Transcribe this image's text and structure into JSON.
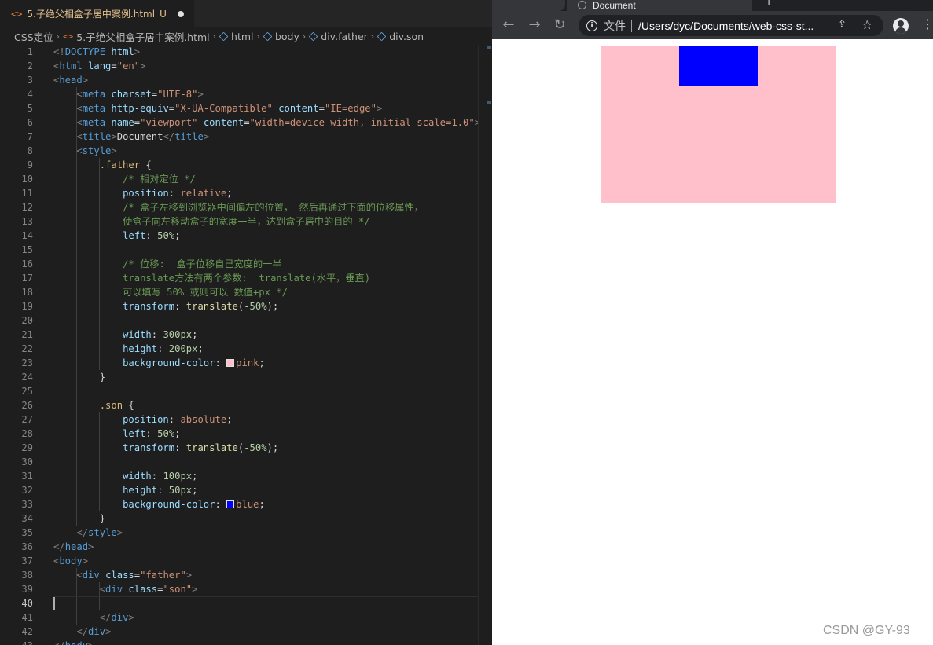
{
  "editor": {
    "tab": {
      "file_icon": "<>",
      "filename": "5.子绝父相盒子居中案例.html",
      "status": "U"
    },
    "breadcrumb": [
      "CSS定位",
      "5.子绝父相盒子居中案例.html",
      "html",
      "body",
      "div.father",
      "div.son"
    ],
    "active_line": 40,
    "lines": [
      [
        {
          "c": "p",
          "t": "<!"
        },
        {
          "c": "t",
          "t": "DOCTYPE"
        },
        {
          "c": "w",
          "t": " "
        },
        {
          "c": "a",
          "t": "html"
        },
        {
          "c": "p",
          "t": ">"
        }
      ],
      [
        {
          "c": "p",
          "t": "<"
        },
        {
          "c": "t",
          "t": "html"
        },
        {
          "c": "w",
          "t": " "
        },
        {
          "c": "a",
          "t": "lang"
        },
        {
          "c": "w",
          "t": "="
        },
        {
          "c": "s",
          "t": "\"en\""
        },
        {
          "c": "p",
          "t": ">"
        }
      ],
      [
        {
          "c": "p",
          "t": "<"
        },
        {
          "c": "t",
          "t": "head"
        },
        {
          "c": "p",
          "t": ">"
        }
      ],
      [
        {
          "c": "w",
          "t": "    "
        },
        {
          "c": "p",
          "t": "<"
        },
        {
          "c": "t",
          "t": "meta"
        },
        {
          "c": "w",
          "t": " "
        },
        {
          "c": "a",
          "t": "charset"
        },
        {
          "c": "w",
          "t": "="
        },
        {
          "c": "s",
          "t": "\"UTF-8\""
        },
        {
          "c": "p",
          "t": ">"
        }
      ],
      [
        {
          "c": "w",
          "t": "    "
        },
        {
          "c": "p",
          "t": "<"
        },
        {
          "c": "t",
          "t": "meta"
        },
        {
          "c": "w",
          "t": " "
        },
        {
          "c": "a",
          "t": "http-equiv"
        },
        {
          "c": "w",
          "t": "="
        },
        {
          "c": "s",
          "t": "\"X-UA-Compatible\""
        },
        {
          "c": "w",
          "t": " "
        },
        {
          "c": "a",
          "t": "content"
        },
        {
          "c": "w",
          "t": "="
        },
        {
          "c": "s",
          "t": "\"IE=edge\""
        },
        {
          "c": "p",
          "t": ">"
        }
      ],
      [
        {
          "c": "w",
          "t": "    "
        },
        {
          "c": "p",
          "t": "<"
        },
        {
          "c": "t",
          "t": "meta"
        },
        {
          "c": "w",
          "t": " "
        },
        {
          "c": "a",
          "t": "name"
        },
        {
          "c": "w",
          "t": "="
        },
        {
          "c": "s",
          "t": "\"viewport\""
        },
        {
          "c": "w",
          "t": " "
        },
        {
          "c": "a",
          "t": "content"
        },
        {
          "c": "w",
          "t": "="
        },
        {
          "c": "s",
          "t": "\"width=device-width, initial-scale=1.0\""
        },
        {
          "c": "p",
          "t": ">"
        }
      ],
      [
        {
          "c": "w",
          "t": "    "
        },
        {
          "c": "p",
          "t": "<"
        },
        {
          "c": "t",
          "t": "title"
        },
        {
          "c": "p",
          "t": ">"
        },
        {
          "c": "w",
          "t": "Document"
        },
        {
          "c": "p",
          "t": "</"
        },
        {
          "c": "t",
          "t": "title"
        },
        {
          "c": "p",
          "t": ">"
        }
      ],
      [
        {
          "c": "w",
          "t": "    "
        },
        {
          "c": "p",
          "t": "<"
        },
        {
          "c": "t",
          "t": "style"
        },
        {
          "c": "p",
          "t": ">"
        }
      ],
      [
        {
          "c": "w",
          "t": "        "
        },
        {
          "c": "sel",
          "t": ".father"
        },
        {
          "c": "w",
          "t": " {"
        }
      ],
      [
        {
          "c": "w",
          "t": "            "
        },
        {
          "c": "c",
          "t": "/* 相对定位 */"
        }
      ],
      [
        {
          "c": "w",
          "t": "            "
        },
        {
          "c": "a",
          "t": "position"
        },
        {
          "c": "w",
          "t": ": "
        },
        {
          "c": "s",
          "t": "relative"
        },
        {
          "c": "w",
          "t": ";"
        }
      ],
      [
        {
          "c": "w",
          "t": "            "
        },
        {
          "c": "c",
          "t": "/* 盒子左移到浏览器中间偏左的位置， 然后再通过下面的位移属性，"
        }
      ],
      [
        {
          "c": "w",
          "t": "            "
        },
        {
          "c": "c",
          "t": "使盒子向左移动盒子的宽度一半，达到盒子居中的目的 */"
        }
      ],
      [
        {
          "c": "w",
          "t": "            "
        },
        {
          "c": "a",
          "t": "left"
        },
        {
          "c": "w",
          "t": ": "
        },
        {
          "c": "n",
          "t": "50%"
        },
        {
          "c": "w",
          "t": ";"
        }
      ],
      [],
      [
        {
          "c": "w",
          "t": "            "
        },
        {
          "c": "c",
          "t": "/* 位移:  盒子位移自己宽度的一半"
        }
      ],
      [
        {
          "c": "w",
          "t": "            "
        },
        {
          "c": "c",
          "t": "translate方法有两个参数:  translate(水平，垂直)"
        }
      ],
      [
        {
          "c": "w",
          "t": "            "
        },
        {
          "c": "c",
          "t": "可以填写 50% 或则可以 数值+px */"
        }
      ],
      [
        {
          "c": "w",
          "t": "            "
        },
        {
          "c": "a",
          "t": "transform"
        },
        {
          "c": "w",
          "t": ": "
        },
        {
          "c": "f",
          "t": "translate"
        },
        {
          "c": "w",
          "t": "("
        },
        {
          "c": "n",
          "t": "-50%"
        },
        {
          "c": "w",
          "t": ");"
        }
      ],
      [],
      [
        {
          "c": "w",
          "t": "            "
        },
        {
          "c": "a",
          "t": "width"
        },
        {
          "c": "w",
          "t": ": "
        },
        {
          "c": "n",
          "t": "300px"
        },
        {
          "c": "w",
          "t": ";"
        }
      ],
      [
        {
          "c": "w",
          "t": "            "
        },
        {
          "c": "a",
          "t": "height"
        },
        {
          "c": "w",
          "t": ": "
        },
        {
          "c": "n",
          "t": "200px"
        },
        {
          "c": "w",
          "t": ";"
        }
      ],
      [
        {
          "c": "w",
          "t": "            "
        },
        {
          "c": "a",
          "t": "background-color"
        },
        {
          "c": "w",
          "t": ": "
        },
        {
          "c": "swatch",
          "t": "#ffc0cb"
        },
        {
          "c": "s",
          "t": "pink"
        },
        {
          "c": "w",
          "t": ";"
        }
      ],
      [
        {
          "c": "w",
          "t": "        }"
        }
      ],
      [],
      [
        {
          "c": "w",
          "t": "        "
        },
        {
          "c": "sel",
          "t": ".son"
        },
        {
          "c": "w",
          "t": " {"
        }
      ],
      [
        {
          "c": "w",
          "t": "            "
        },
        {
          "c": "a",
          "t": "position"
        },
        {
          "c": "w",
          "t": ": "
        },
        {
          "c": "s",
          "t": "absolute"
        },
        {
          "c": "w",
          "t": ";"
        }
      ],
      [
        {
          "c": "w",
          "t": "            "
        },
        {
          "c": "a",
          "t": "left"
        },
        {
          "c": "w",
          "t": ": "
        },
        {
          "c": "n",
          "t": "50%"
        },
        {
          "c": "w",
          "t": ";"
        }
      ],
      [
        {
          "c": "w",
          "t": "            "
        },
        {
          "c": "a",
          "t": "transform"
        },
        {
          "c": "w",
          "t": ": "
        },
        {
          "c": "f",
          "t": "translate"
        },
        {
          "c": "w",
          "t": "("
        },
        {
          "c": "n",
          "t": "-50%"
        },
        {
          "c": "w",
          "t": ");"
        }
      ],
      [],
      [
        {
          "c": "w",
          "t": "            "
        },
        {
          "c": "a",
          "t": "width"
        },
        {
          "c": "w",
          "t": ": "
        },
        {
          "c": "n",
          "t": "100px"
        },
        {
          "c": "w",
          "t": ";"
        }
      ],
      [
        {
          "c": "w",
          "t": "            "
        },
        {
          "c": "a",
          "t": "height"
        },
        {
          "c": "w",
          "t": ": "
        },
        {
          "c": "n",
          "t": "50px"
        },
        {
          "c": "w",
          "t": ";"
        }
      ],
      [
        {
          "c": "w",
          "t": "            "
        },
        {
          "c": "a",
          "t": "background-color"
        },
        {
          "c": "w",
          "t": ": "
        },
        {
          "c": "swatch",
          "t": "#0000ff"
        },
        {
          "c": "s",
          "t": "blue"
        },
        {
          "c": "w",
          "t": ";"
        }
      ],
      [
        {
          "c": "w",
          "t": "        }"
        }
      ],
      [
        {
          "c": "w",
          "t": "    "
        },
        {
          "c": "p",
          "t": "</"
        },
        {
          "c": "t",
          "t": "style"
        },
        {
          "c": "p",
          "t": ">"
        }
      ],
      [
        {
          "c": "p",
          "t": "</"
        },
        {
          "c": "t",
          "t": "head"
        },
        {
          "c": "p",
          "t": ">"
        }
      ],
      [
        {
          "c": "p",
          "t": "<"
        },
        {
          "c": "t",
          "t": "body"
        },
        {
          "c": "p",
          "t": ">"
        }
      ],
      [
        {
          "c": "w",
          "t": "    "
        },
        {
          "c": "p",
          "t": "<"
        },
        {
          "c": "t",
          "t": "div"
        },
        {
          "c": "w",
          "t": " "
        },
        {
          "c": "a",
          "t": "class"
        },
        {
          "c": "w",
          "t": "="
        },
        {
          "c": "s",
          "t": "\"father\""
        },
        {
          "c": "p",
          "t": ">"
        }
      ],
      [
        {
          "c": "w",
          "t": "        "
        },
        {
          "c": "p",
          "t": "<"
        },
        {
          "c": "t",
          "t": "div"
        },
        {
          "c": "w",
          "t": " "
        },
        {
          "c": "a",
          "t": "class"
        },
        {
          "c": "w",
          "t": "="
        },
        {
          "c": "s",
          "t": "\"son\""
        },
        {
          "c": "p",
          "t": ">"
        }
      ],
      [],
      [
        {
          "c": "w",
          "t": "        "
        },
        {
          "c": "p",
          "t": "</"
        },
        {
          "c": "t",
          "t": "div"
        },
        {
          "c": "p",
          "t": ">"
        }
      ],
      [
        {
          "c": "w",
          "t": "    "
        },
        {
          "c": "p",
          "t": "</"
        },
        {
          "c": "t",
          "t": "div"
        },
        {
          "c": "p",
          "t": ">"
        }
      ],
      [
        {
          "c": "p",
          "t": "</"
        },
        {
          "c": "t",
          "t": "body"
        },
        {
          "c": "p",
          "t": ">"
        }
      ]
    ]
  },
  "browser": {
    "tab_title": "Document",
    "new_tab": "+",
    "address_label": "文件",
    "url": "/Users/dyc/Documents/web-css-st...",
    "back_icon": "arrow-left-icon",
    "forward_icon": "arrow-right-icon",
    "reload_icon": "reload-icon",
    "share_icon": "share-icon",
    "star_icon": "star-icon",
    "profile_icon": "profile-icon",
    "menu_icon": "kebab-menu-icon",
    "page": {
      "father_color": "pink",
      "son_color": "blue"
    }
  },
  "watermark": "CSDN @GY-93"
}
